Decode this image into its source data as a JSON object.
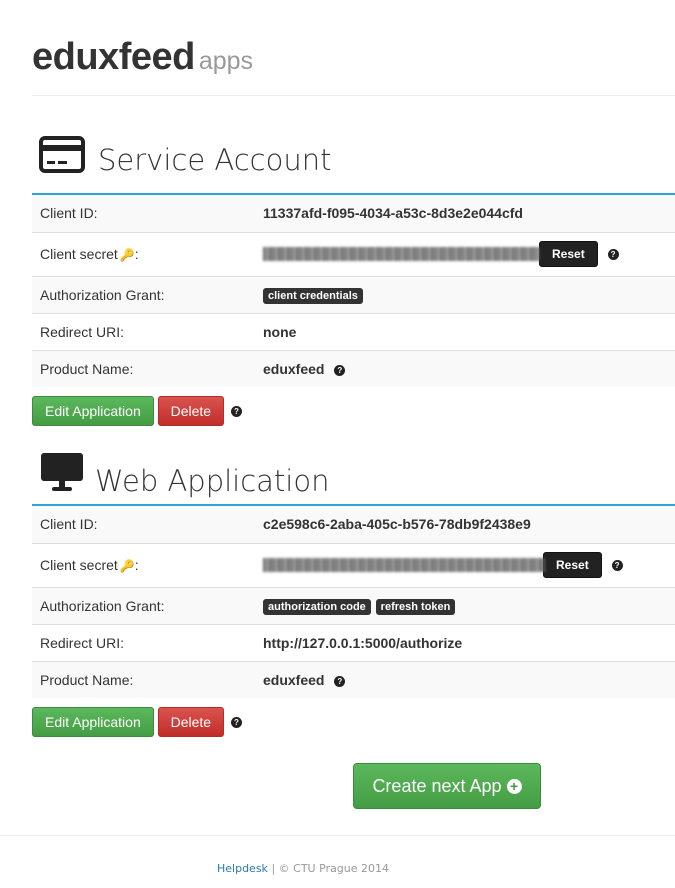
{
  "header": {
    "brand": "eduxfeed",
    "subtitle": "apps"
  },
  "apps": [
    {
      "title": "Service Account",
      "icon": "credit-card-icon",
      "rows": {
        "client_id_label": "Client ID:",
        "client_id": "11337afd-f095-4034-a53c-8d3e2e044cfd",
        "client_secret_label": "Client secret",
        "reset_label": "Reset",
        "grant_label": "Authorization Grant:",
        "grants": [
          "client credentials"
        ],
        "redirect_label": "Redirect URI:",
        "redirect": "none",
        "product_label": "Product Name:",
        "product": "eduxfeed"
      },
      "edit_label": "Edit Application",
      "delete_label": "Delete"
    },
    {
      "title": "Web Application",
      "icon": "monitor-icon",
      "rows": {
        "client_id_label": "Client ID:",
        "client_id": "c2e598c6-2aba-405c-b576-78db9f2438e9",
        "client_secret_label": "Client secret",
        "reset_label": "Reset",
        "grant_label": "Authorization Grant:",
        "grants": [
          "authorization code",
          "refresh token"
        ],
        "redirect_label": "Redirect URI:",
        "redirect": "http://127.0.0.1:5000/authorize",
        "product_label": "Product Name:",
        "product": "eduxfeed"
      },
      "edit_label": "Edit Application",
      "delete_label": "Delete"
    }
  ],
  "create_button": "Create next App",
  "footer": {
    "link": "Helpdesk",
    "separator": "|",
    "copyright": "© CTU Prague 2014"
  },
  "colors": {
    "accent": "#2ea3d7",
    "success": "#5cb85c",
    "danger": "#d9534f",
    "dark": "#222222"
  }
}
